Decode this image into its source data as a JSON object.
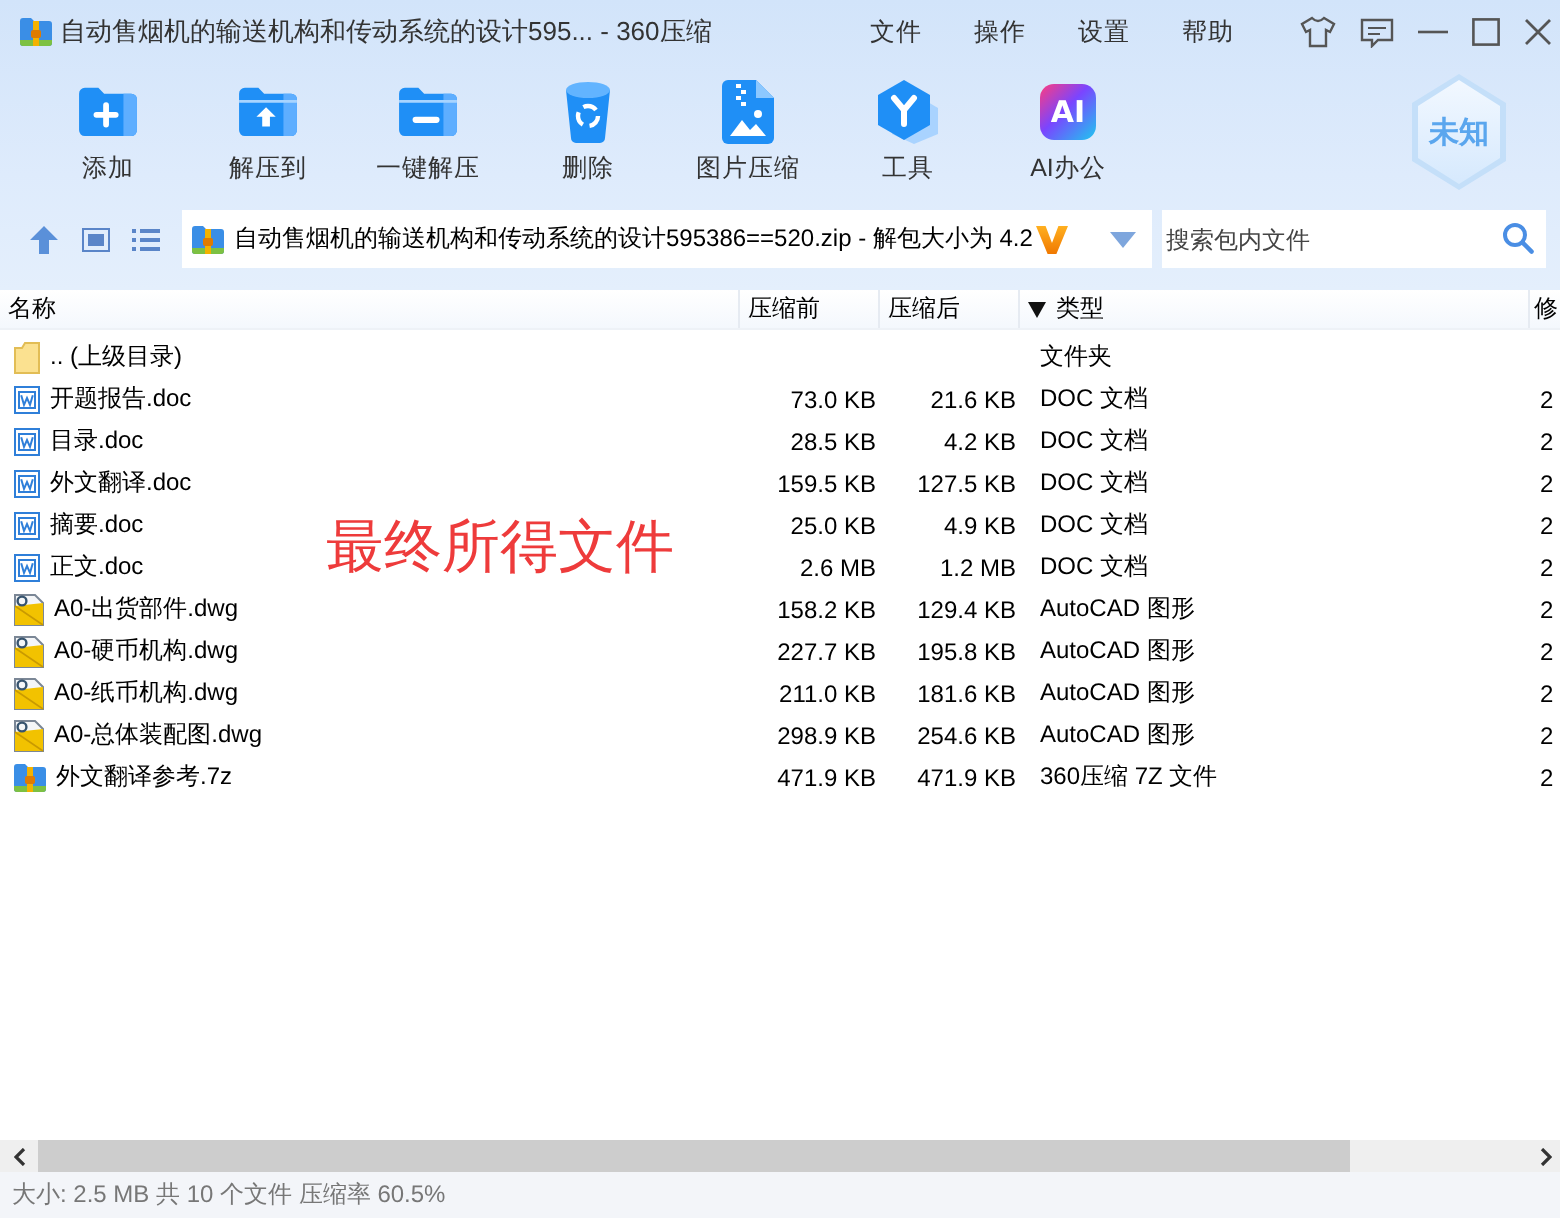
{
  "window": {
    "title": "自动售烟机的输送机构和传动系统的设计595... - 360压缩",
    "menu": [
      "文件",
      "操作",
      "设置",
      "帮助"
    ]
  },
  "toolbar": {
    "buttons": [
      {
        "kind": "add",
        "label": "添加"
      },
      {
        "kind": "extract_to",
        "label": "解压到"
      },
      {
        "kind": "one_click_extract",
        "label": "一键解压"
      },
      {
        "kind": "delete",
        "label": "删除"
      },
      {
        "kind": "image_compress",
        "label": "图片压缩"
      },
      {
        "kind": "tools",
        "label": "工具"
      },
      {
        "kind": "ai",
        "label": "AI办公",
        "icon_text": "AI"
      }
    ],
    "shield_badge": "未知"
  },
  "address_bar": {
    "path": "自动售烟机的输送机构和传动系统的设计595386==520.zip - 解包大小为 4.2",
    "search": {
      "placeholder": "搜索包内文件"
    }
  },
  "table": {
    "columns": [
      {
        "label": "名称",
        "sorted": false
      },
      {
        "label": "压缩前",
        "sorted": false
      },
      {
        "label": "压缩后",
        "sorted": false
      },
      {
        "label": "类型",
        "sorted": true
      },
      {
        "label": "修",
        "sorted": false
      }
    ],
    "rows": [
      {
        "kind": "folder",
        "name": ".. (上级目录)",
        "type": "文件夹"
      },
      {
        "kind": "doc",
        "name": "开题报告.doc",
        "original_size": "73.0 KB",
        "packed_size": "21.6 KB",
        "type": "DOC 文档",
        "column_5": "2"
      },
      {
        "kind": "doc",
        "name": "目录.doc",
        "original_size": "28.5 KB",
        "packed_size": "4.2 KB",
        "type": "DOC 文档",
        "column_5": "2"
      },
      {
        "kind": "doc",
        "name": "外文翻译.doc",
        "original_size": "159.5 KB",
        "packed_size": "127.5 KB",
        "type": "DOC 文档",
        "column_5": "2"
      },
      {
        "kind": "doc",
        "name": "摘要.doc",
        "original_size": "25.0 KB",
        "packed_size": "4.9 KB",
        "type": "DOC 文档",
        "column_5": "2"
      },
      {
        "kind": "doc",
        "name": "正文.doc",
        "original_size": "2.6 MB",
        "packed_size": "1.2 MB",
        "type": "DOC 文档",
        "column_5": "2"
      },
      {
        "kind": "dwg",
        "name": "A0-出货部件.dwg",
        "original_size": "158.2 KB",
        "packed_size": "129.4 KB",
        "type": "AutoCAD 图形",
        "column_5": "2"
      },
      {
        "kind": "dwg",
        "name": "A0-硬币机构.dwg",
        "original_size": "227.7 KB",
        "packed_size": "195.8 KB",
        "type": "AutoCAD 图形",
        "column_5": "2"
      },
      {
        "kind": "dwg",
        "name": "A0-纸币机构.dwg",
        "original_size": "211.0 KB",
        "packed_size": "181.6 KB",
        "type": "AutoCAD 图形",
        "column_5": "2"
      },
      {
        "kind": "dwg",
        "name": "A0-总体装配图.dwg",
        "original_size": "298.9 KB",
        "packed_size": "254.6 KB",
        "type": "AutoCAD 图形",
        "column_5": "2"
      },
      {
        "kind": "archive",
        "name": "外文翻译参考.7z",
        "original_size": "471.9 KB",
        "packed_size": "471.9 KB",
        "type": "360压缩 7Z 文件",
        "column_5": "2"
      }
    ]
  },
  "annotation": "最终所得文件",
  "status_bar": "大小: 2.5 MB 共 10 个文件 压缩率 60.5%"
}
